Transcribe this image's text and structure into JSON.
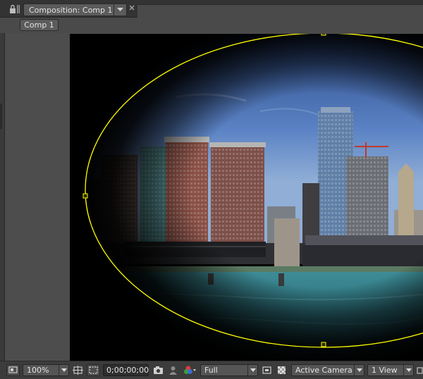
{
  "panel": {
    "tab_title": "Composition: Comp 1",
    "breadcrumb": "Comp 1"
  },
  "toolbar": {
    "magnification": "100%",
    "timecode": "0;00;00;00",
    "resolution": "Full",
    "camera": "Active Camera",
    "views": "1 View"
  },
  "mask": {
    "color": "#ffff00",
    "shape": "ellipse"
  },
  "colors": {
    "panel_bg": "#4a4a4a",
    "tab_bar": "#333333",
    "toolbar_bg": "#3c3c3c",
    "accent_mask": "#ffff00"
  }
}
